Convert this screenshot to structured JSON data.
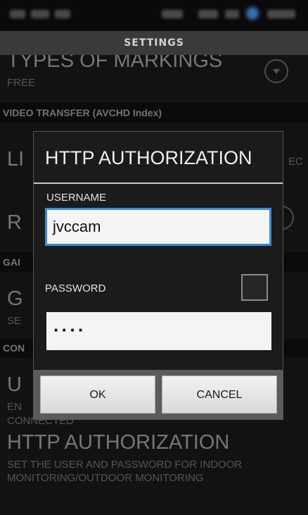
{
  "header": {
    "title": "SETTINGS"
  },
  "background": {
    "row1": {
      "title": "TYPES OF MARKINGS",
      "value": "FREE"
    },
    "section1": "VIDEO TRANSFER (AVCHD Index)",
    "row2": {
      "title_partial": "LI",
      "right_partial": "EC"
    },
    "row3": {
      "title_partial": "R"
    },
    "section2_partial": "GAI",
    "row4": {
      "title_partial": "G",
      "sub_partial": "SE"
    },
    "section3_partial": "CON",
    "row5": {
      "title_partial": "U",
      "sub1_partial": "EN",
      "sub2": "CONNECTED"
    },
    "row6": {
      "title": "HTTP AUTHORIZATION",
      "sub1": "SET THE USER AND PASSWORD FOR INDOOR",
      "sub2": "MONITORING/OUTDOOR MONITORING"
    }
  },
  "dialog": {
    "title": "HTTP AUTHORIZATION",
    "username_label": "USERNAME",
    "username_value": "jvccam",
    "password_label": "PASSWORD",
    "password_value": "····",
    "show_password_checked": false,
    "ok_label": "OK",
    "cancel_label": "CANCEL"
  },
  "colors": {
    "focus_border": "#3a8bd8",
    "header_bg": "#3a3a3a",
    "dialog_bg": "#1b1b1b"
  }
}
